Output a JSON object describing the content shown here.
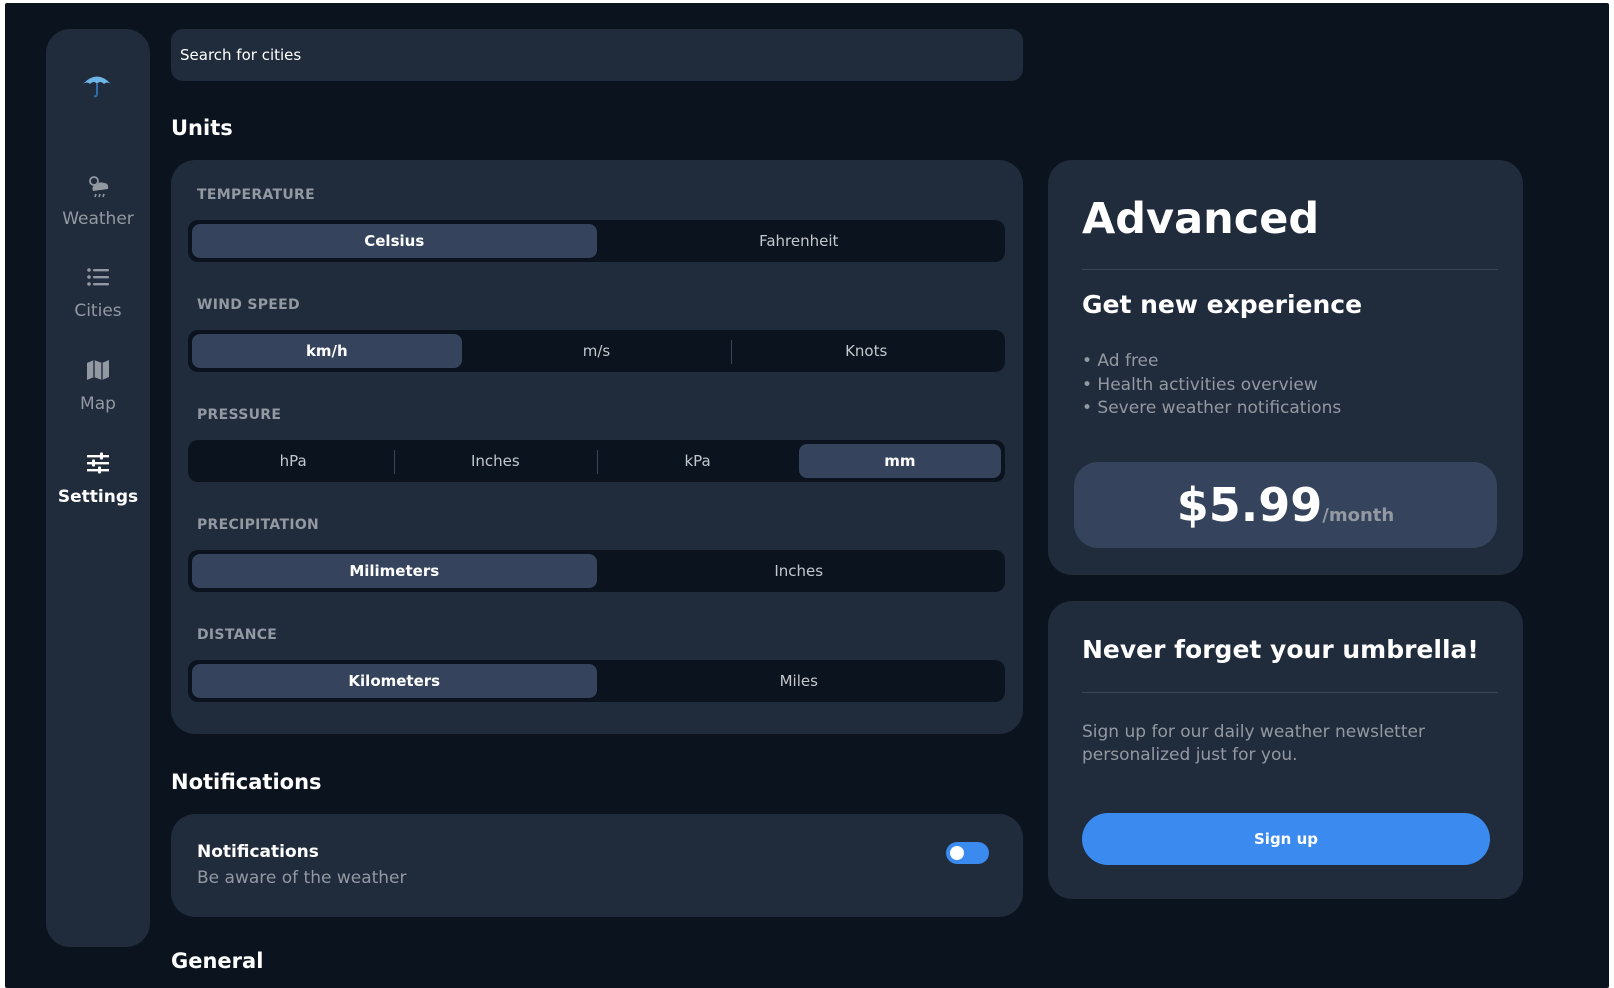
{
  "search": {
    "placeholder": "Search for cities"
  },
  "sidebar": {
    "logo_icon": "umbrella-icon",
    "items": [
      {
        "label": "Weather",
        "icon": "cloud-sun-rain-icon",
        "active": false
      },
      {
        "label": "Cities",
        "icon": "list-icon",
        "active": false
      },
      {
        "label": "Map",
        "icon": "map-icon",
        "active": false
      },
      {
        "label": "Settings",
        "icon": "sliders-icon",
        "active": true
      }
    ]
  },
  "units": {
    "title": "Units",
    "temperature": {
      "label": "TEMPERATURE",
      "options": [
        "Celsius",
        "Fahrenheit"
      ],
      "selected": "Celsius"
    },
    "wind_speed": {
      "label": "WIND SPEED",
      "options": [
        "km/h",
        "m/s",
        "Knots"
      ],
      "selected": "km/h"
    },
    "pressure": {
      "label": "PRESSURE",
      "options": [
        "hPa",
        "Inches",
        "kPa",
        "mm"
      ],
      "selected": "mm"
    },
    "precipitation": {
      "label": "PRECIPITATION",
      "options": [
        "Milimeters",
        "Inches"
      ],
      "selected": "Milimeters"
    },
    "distance": {
      "label": "DISTANCE",
      "options": [
        "Kilometers",
        "Miles"
      ],
      "selected": "Kilometers"
    }
  },
  "notifications": {
    "section_title": "Notifications",
    "item_title": "Notifications",
    "item_subtitle": "Be aware of the weather",
    "enabled": true
  },
  "advanced": {
    "title": "Advanced",
    "subtitle": "Get new experience",
    "features": [
      "• Ad free",
      "• Health activities overview",
      "• Severe weather notifications"
    ],
    "price": "$5.99",
    "period": "/month"
  },
  "newsletter": {
    "title": "Never forget your umbrella!",
    "text": "Sign up for our daily weather newsletter personalized just for you.",
    "button": "Sign up"
  },
  "general": {
    "title": "General"
  },
  "colors": {
    "background": "#0b131e",
    "card": "#202b3b",
    "selected": "#35445c",
    "accent": "#3a8af0",
    "muted_text": "#9399a2"
  }
}
